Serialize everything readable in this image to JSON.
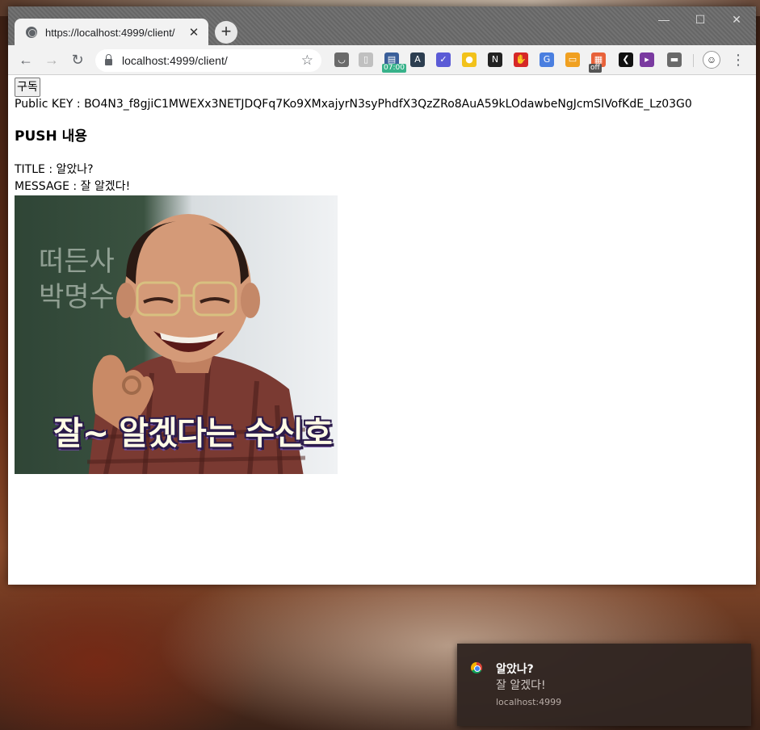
{
  "browser": {
    "tab_title": "https://localhost:4999/client/",
    "tab_close": "✕",
    "new_tab": "+",
    "window_controls": {
      "minimize": "—",
      "maximize": "☐",
      "close": "✕"
    },
    "nav": {
      "back": "←",
      "forward": "→",
      "reload": "↻"
    },
    "url": "localhost:4999/client/",
    "star": "☆",
    "extensions": [
      {
        "name": "pocket-icon",
        "glyph": "◡",
        "color": "#6a6a6a"
      },
      {
        "name": "mouse-icon",
        "glyph": "▯",
        "color": "#c0c0c0"
      },
      {
        "name": "timer-icon",
        "glyph": "▤",
        "color": "#3a5f9a",
        "badge": "07:00",
        "badge_color": "#38b28a"
      },
      {
        "name": "a-extension-icon",
        "glyph": "A",
        "color": "#2c3e50"
      },
      {
        "name": "check-extension-icon",
        "glyph": "✓",
        "color": "#5b5bd6"
      },
      {
        "name": "yellow-circle-icon",
        "glyph": "●",
        "color": "#f2c21b"
      },
      {
        "name": "notion-icon",
        "glyph": "N",
        "color": "#222222"
      },
      {
        "name": "stop-hand-icon",
        "glyph": "✋",
        "color": "#d62828"
      },
      {
        "name": "translate-icon",
        "glyph": "G",
        "color": "#4a7fe0"
      },
      {
        "name": "folder-icon",
        "glyph": "▭",
        "color": "#f0a020"
      },
      {
        "name": "off-extension-icon",
        "glyph": "▦",
        "color": "#e8623a",
        "badge": "off",
        "badge_color": "#555555"
      },
      {
        "name": "chevron-left-icon",
        "glyph": "❮",
        "color": "#111111"
      },
      {
        "name": "flag-icon",
        "glyph": "▸",
        "color": "#7a3aa0"
      },
      {
        "name": "screen-icon",
        "glyph": "▬",
        "color": "#6a6a6a"
      }
    ],
    "menu": "⋮"
  },
  "page": {
    "subscribe_button": "구독",
    "public_key_line": "Public KEY : BO4N3_f8gjiC1MWEXx3NETJDQFq7Ko9XMxajyrN3syPhdfX3QzZRo8AuA59kLOdawbeNgJcmSIVofKdE_Lz03G0",
    "heading": "PUSH 내용",
    "title_line": "TITLE : 알았나?",
    "message_line": "MESSAGE : 잘 알겠다!",
    "image_caption": "잘~ 알겠다는 수신호"
  },
  "notification": {
    "title": "알았나?",
    "message": "잘 알겠다!",
    "origin": "localhost:4999"
  }
}
